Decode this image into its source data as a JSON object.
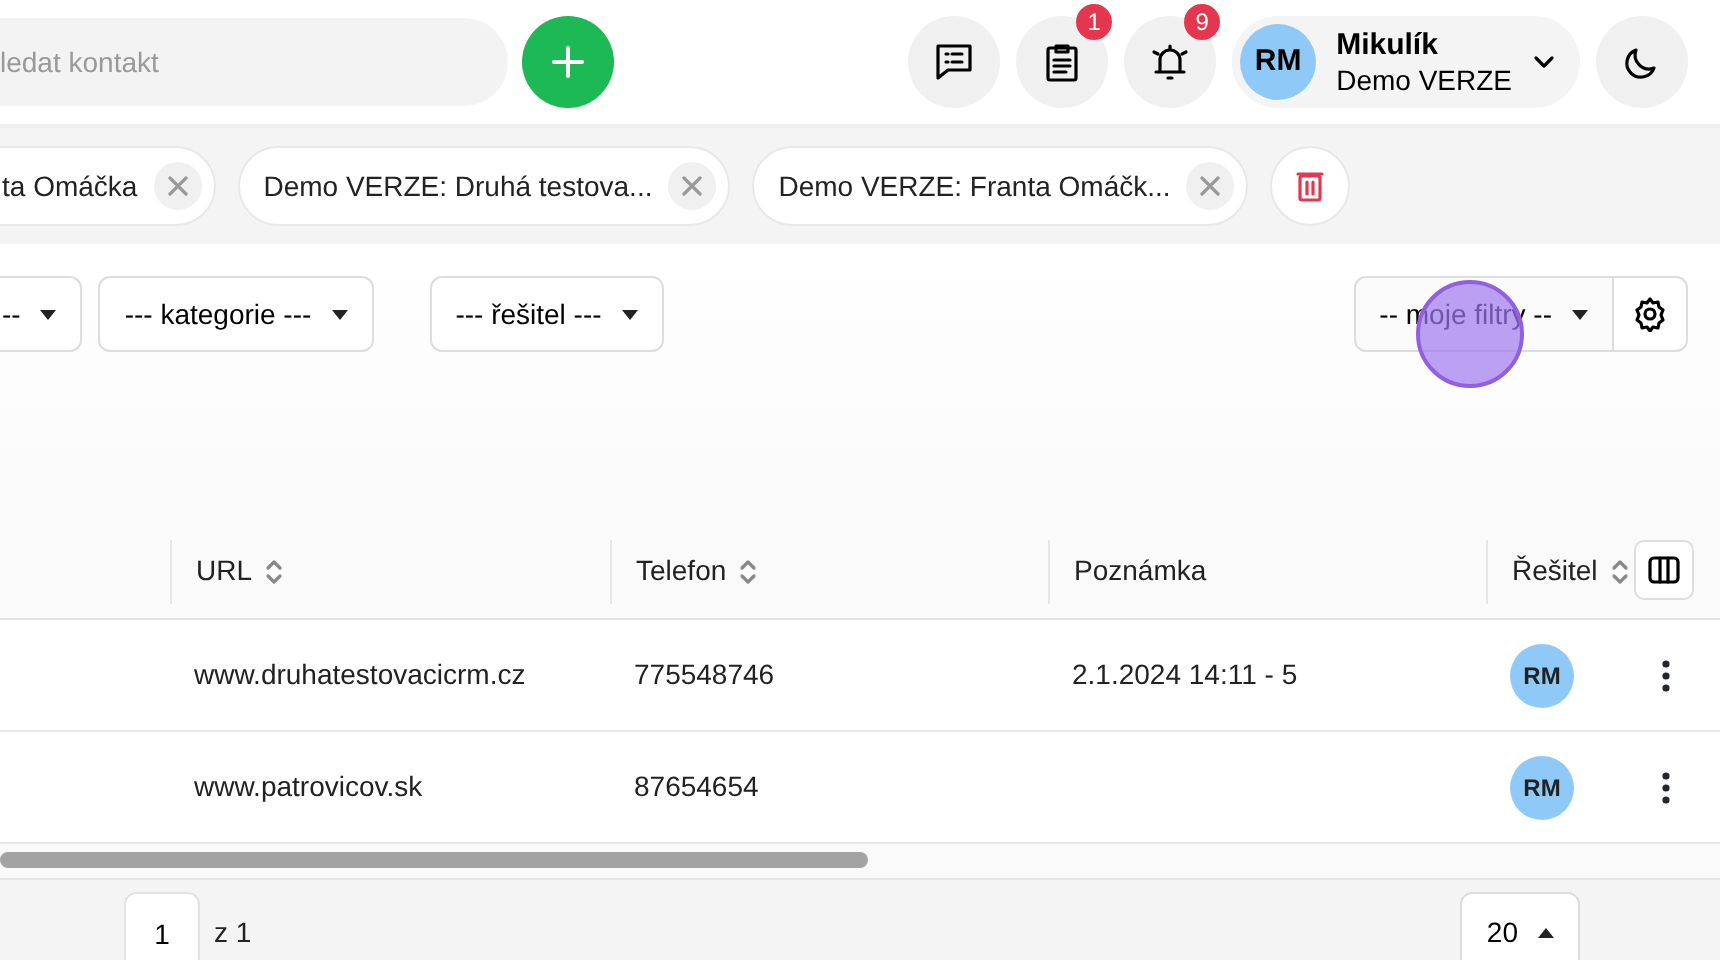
{
  "search": {
    "placeholder": "ledat kontakt"
  },
  "header_buttons": [
    {
      "kind": "messages"
    },
    {
      "kind": "tasks",
      "badge": "1"
    },
    {
      "kind": "alerts",
      "badge": "9"
    }
  ],
  "user": {
    "initials": "RM",
    "name": "Mikulík",
    "subtitle": "Demo VERZE"
  },
  "open_tabs": [
    {
      "label": "ta Omáčka"
    },
    {
      "label": "Demo VERZE: Druhá testova..."
    },
    {
      "label": "Demo VERZE: Franta Omáčk..."
    }
  ],
  "filters": [
    {
      "label": "--"
    },
    {
      "label": "--- kategorie ---"
    },
    {
      "label": "--- řešitel ---"
    }
  ],
  "my_filters": {
    "label": "-- moje filtry --"
  },
  "table": {
    "columns": [
      {
        "label": "URL",
        "sortable": true
      },
      {
        "label": "Telefon",
        "sortable": true
      },
      {
        "label": "Poznámka",
        "sortable": false
      },
      {
        "label": "Řešitel",
        "sortable": true
      }
    ],
    "rows": [
      {
        "url": "www.druhatestovacicrm.cz",
        "phone": "775548746",
        "note": "2.1.2024 14:11 - 5",
        "assignee": "RM"
      },
      {
        "url": "www.patrovicov.sk",
        "phone": "87654654",
        "note": "",
        "assignee": "RM"
      }
    ]
  },
  "pagination": {
    "page": "1",
    "of": "z 1",
    "page_size": "20"
  }
}
